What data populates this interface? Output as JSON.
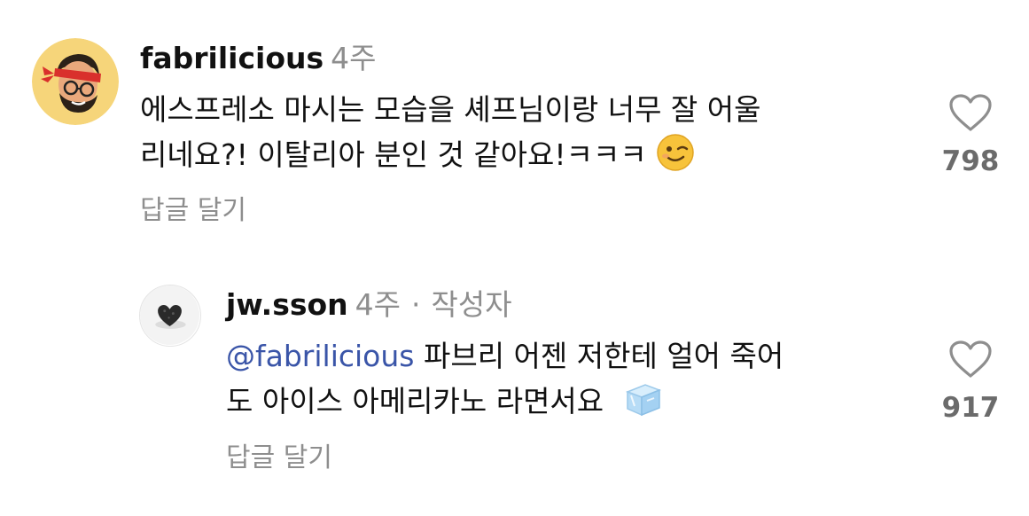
{
  "comments": [
    {
      "username": "fabrilicious",
      "time": "4주",
      "text_line1": "에스프레소 마시는 모습을 셰프님이랑 너무 잘 어울",
      "text_line2": "리네요?! 이탈리아 분인 것 같아요!ㅋㅋㅋ",
      "emoji_icon": "winking-face-icon",
      "reply_label": "답글 달기",
      "like_count": "798"
    },
    {
      "username": "jw.sson",
      "time": "4주",
      "separator": "·",
      "author_badge": "작성자",
      "mention": "@fabrilicious",
      "text_line1_rest": " 파브리 어젠 저한테 얼어 죽어",
      "text_line2": "도 아이스 아메리카노 라면서요",
      "emoji_icon": "ice-cube-icon",
      "reply_label": "답글 달기",
      "like_count": "917"
    }
  ],
  "colors": {
    "mention": "#3a55a8",
    "meta": "#8e8e8e",
    "avatar_bg": "#f6d57a",
    "headband": "#d9302c"
  }
}
